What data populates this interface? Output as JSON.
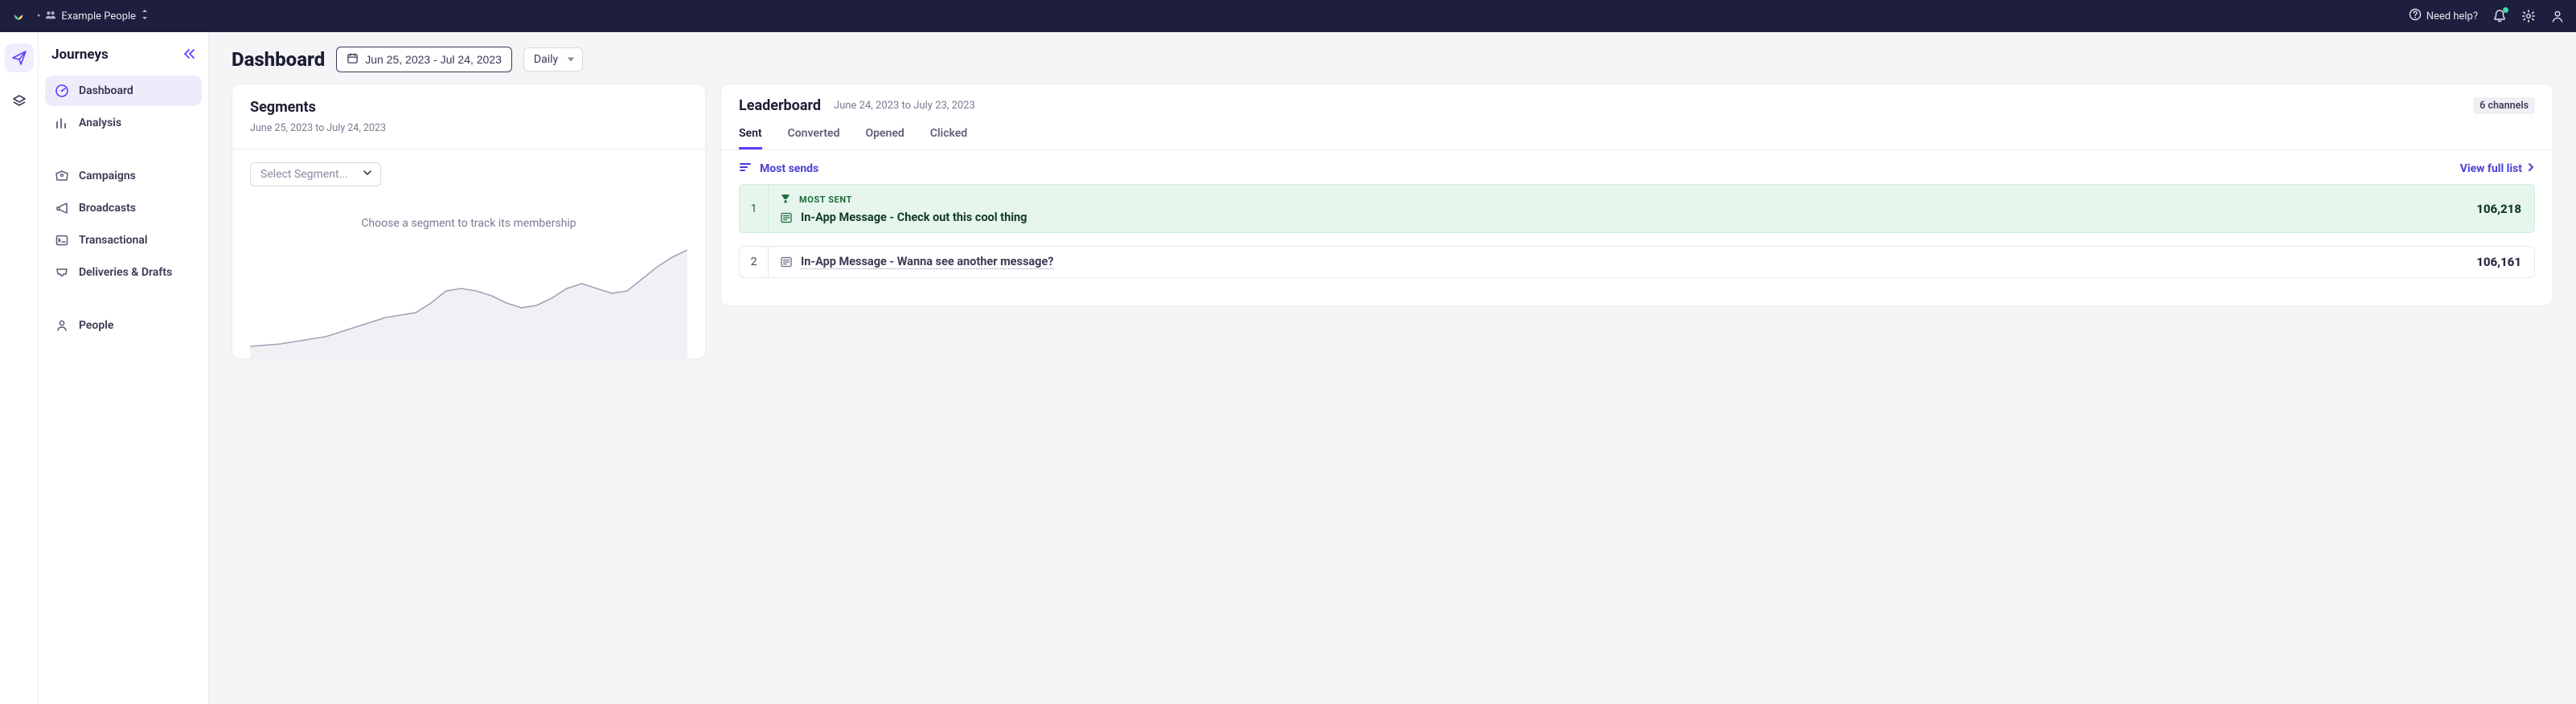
{
  "colors": {
    "accent": "#5b3eff",
    "headerBg": "#1e1f3e",
    "success": "#1e6b3d"
  },
  "header": {
    "workspace_dirty_marker": "•",
    "workspace_name": "Example People",
    "help_label": "Need help?"
  },
  "nav": {
    "title": "Journeys",
    "items": [
      {
        "id": "dashboard",
        "label": "Dashboard",
        "icon": "gauge"
      },
      {
        "id": "analysis",
        "label": "Analysis",
        "icon": "bar-chart"
      }
    ],
    "items2": [
      {
        "id": "campaigns",
        "label": "Campaigns",
        "icon": "megaphone-tag"
      },
      {
        "id": "broadcasts",
        "label": "Broadcasts",
        "icon": "megaphone"
      },
      {
        "id": "transactional",
        "label": "Transactional",
        "icon": "terminal"
      },
      {
        "id": "deliveries",
        "label": "Deliveries & Drafts",
        "icon": "inbox"
      }
    ],
    "items3": [
      {
        "id": "people",
        "label": "People",
        "icon": "user"
      }
    ]
  },
  "page": {
    "title": "Dashboard",
    "date_range": "Jun 25, 2023 - Jul 24, 2023",
    "frequency": "Daily"
  },
  "segments": {
    "title": "Segments",
    "date_range": "June 25, 2023 to July 24, 2023",
    "select_placeholder": "Select Segment...",
    "hint": "Choose a segment to track its membership"
  },
  "leaderboard": {
    "title": "Leaderboard",
    "date_range": "June 24, 2023 to July 23, 2023",
    "channels_label": "6 channels",
    "tabs": [
      "Sent",
      "Converted",
      "Opened",
      "Clicked"
    ],
    "active_tab": "Sent",
    "section_label": "Most sends",
    "view_full_label": "View full list",
    "rows": [
      {
        "rank": 1,
        "tag": "MOST SENT",
        "name": "In-App Message - Check out this cool thing",
        "value": "106,218"
      },
      {
        "rank": 2,
        "name": "In-App Message - Wanna see another message?",
        "value": "106,161"
      }
    ]
  },
  "chart_data": {
    "type": "line",
    "title": "",
    "xlabel": "",
    "ylabel": "",
    "x_range_label": "June 25, 2023 to July 24, 2023",
    "x": [
      0,
      1,
      2,
      3,
      4,
      5,
      6,
      7,
      8,
      9,
      10,
      11,
      12,
      13,
      14,
      15,
      16,
      17,
      18,
      19,
      20,
      21,
      22,
      23,
      24,
      25,
      26,
      27,
      28,
      29
    ],
    "values": [
      10,
      11,
      12,
      14,
      16,
      18,
      22,
      26,
      30,
      34,
      36,
      38,
      46,
      56,
      58,
      56,
      52,
      46,
      42,
      44,
      50,
      58,
      62,
      58,
      54,
      56,
      66,
      76,
      84,
      90
    ],
    "ylim": [
      0,
      100
    ],
    "note": "Axis scale is approximate (no tick labels shown); values are relative membership trend shape read from the plotted curve."
  }
}
